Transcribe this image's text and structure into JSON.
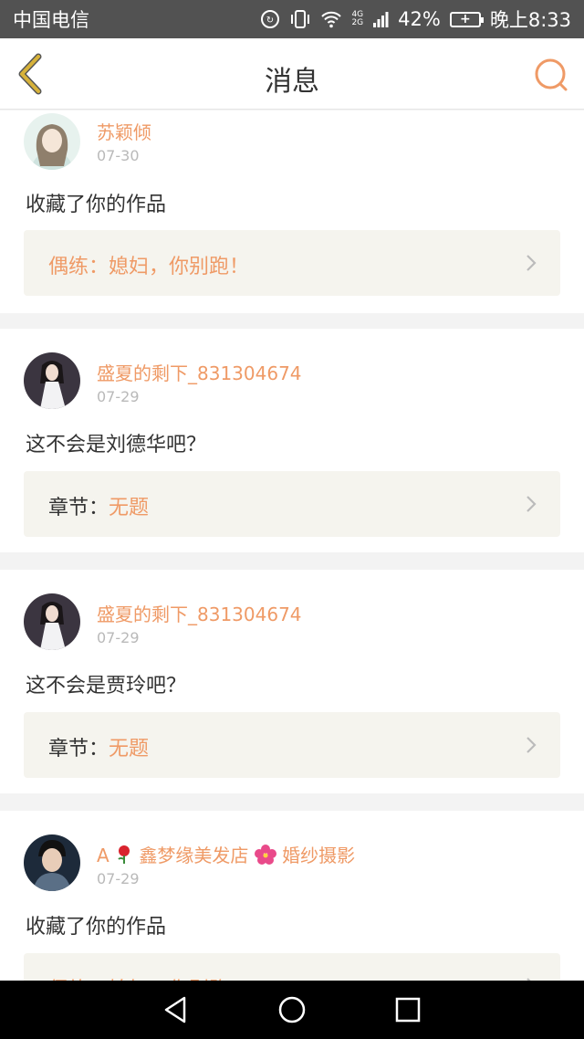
{
  "status_bar": {
    "carrier": "中国电信",
    "net_top": "4G",
    "net_bottom": "2G",
    "battery_percent": "42%",
    "time": "晚上8:33"
  },
  "header": {
    "title": "消息"
  },
  "messages": [
    {
      "user": "苏颖倾",
      "date": "07-30",
      "action": "收藏了你的作品",
      "ref_text": "偶练：媳妇，你别跑！"
    },
    {
      "user": "盛夏的剩下_831304674",
      "date": "07-29",
      "action": "这不会是刘德华吧？",
      "ref_prefix": "章节：",
      "ref_value": "无题"
    },
    {
      "user": "盛夏的剩下_831304674",
      "date": "07-29",
      "action": "这不会是贾玲吧？",
      "ref_prefix": "章节：",
      "ref_value": "无题"
    },
    {
      "user_parts": [
        "A",
        "鑫梦缘美发店",
        "婚纱摄影"
      ],
      "date": "07-29",
      "action": "收藏了你的作品",
      "ref_text": "偶练：媳妇，你别跑！"
    }
  ],
  "colors": {
    "accent": "#ef9a66",
    "back_arrow": "#d7b23a",
    "ref_bg": "#f5f4ee"
  }
}
